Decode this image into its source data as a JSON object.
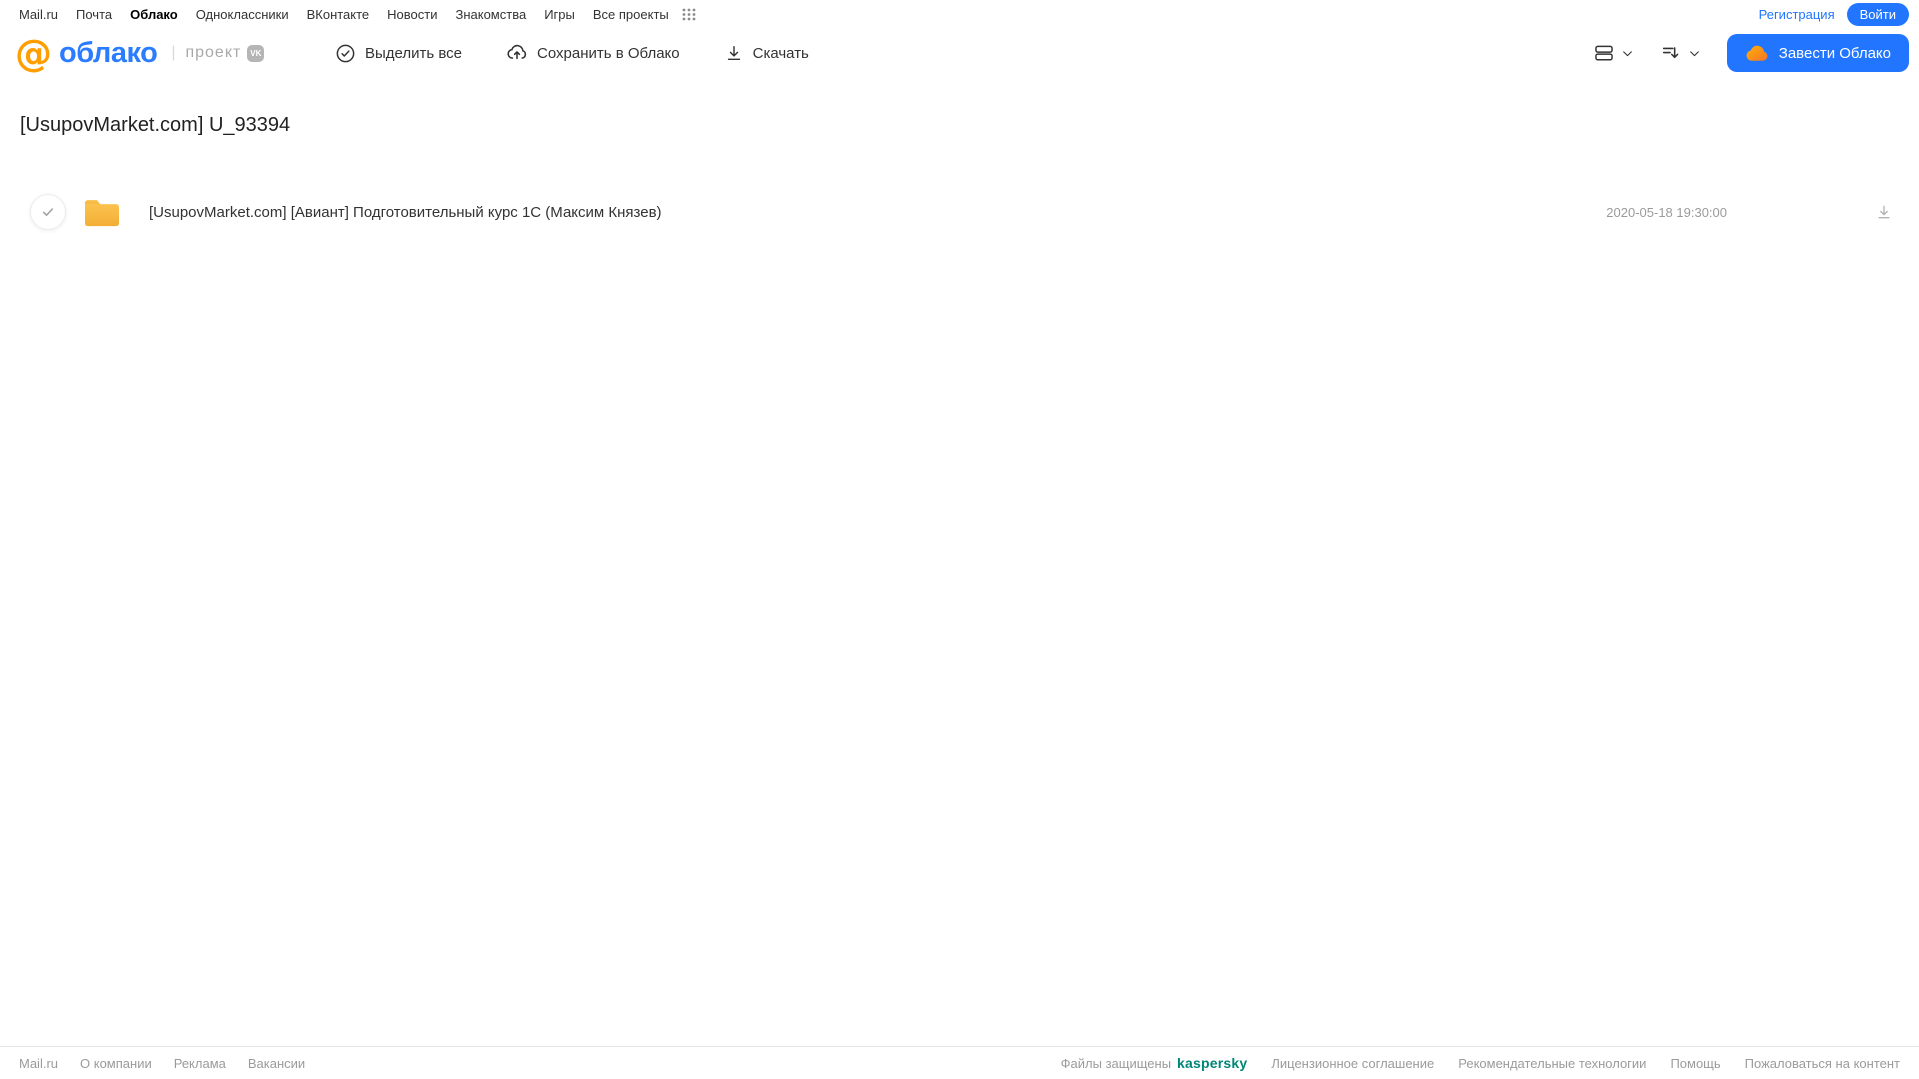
{
  "top_nav": {
    "items": [
      {
        "label": "Mail.ru",
        "active": false
      },
      {
        "label": "Почта",
        "active": false
      },
      {
        "label": "Облако",
        "active": true
      },
      {
        "label": "Одноклассники",
        "active": false
      },
      {
        "label": "ВКонтакте",
        "active": false
      },
      {
        "label": "Новости",
        "active": false
      },
      {
        "label": "Знакомства",
        "active": false
      },
      {
        "label": "Игры",
        "active": false
      },
      {
        "label": "Все проекты",
        "active": false
      }
    ],
    "registration_label": "Регистрация",
    "login_label": "Войти"
  },
  "header": {
    "logo_at": "@",
    "logo_text": "облако",
    "project_label": "проект",
    "vk_badge": "VK",
    "toolbar": {
      "select_all_label": "Выделить все",
      "save_to_cloud_label": "Сохранить в Облако",
      "download_label": "Скачать"
    },
    "get_cloud_label": "Завести Облако"
  },
  "main": {
    "title": "[UsupovMarket.com] U_93394",
    "files": [
      {
        "type": "folder",
        "name": "[UsupovMarket.com] [Авиант] Подготовительный курс 1С (Максим Князев)",
        "date": "2020-05-18 19:30:00"
      }
    ]
  },
  "footer": {
    "left_links": [
      "Mail.ru",
      "О компании",
      "Реклама",
      "Вакансии"
    ],
    "protected_text": "Файлы защищены",
    "kaspersky_label": "kaspersky",
    "right_links": [
      "Лицензионное соглашение",
      "Рекомендательные технологии",
      "Помощь",
      "Пожаловаться на контент"
    ]
  },
  "colors": {
    "accent_blue": "#2175ff",
    "logo_orange": "#ff9e00",
    "folder_yellow": "#f7b84a",
    "kaspersky_green": "#008577",
    "text_dark": "#333333",
    "text_muted": "#9b9b9b"
  }
}
